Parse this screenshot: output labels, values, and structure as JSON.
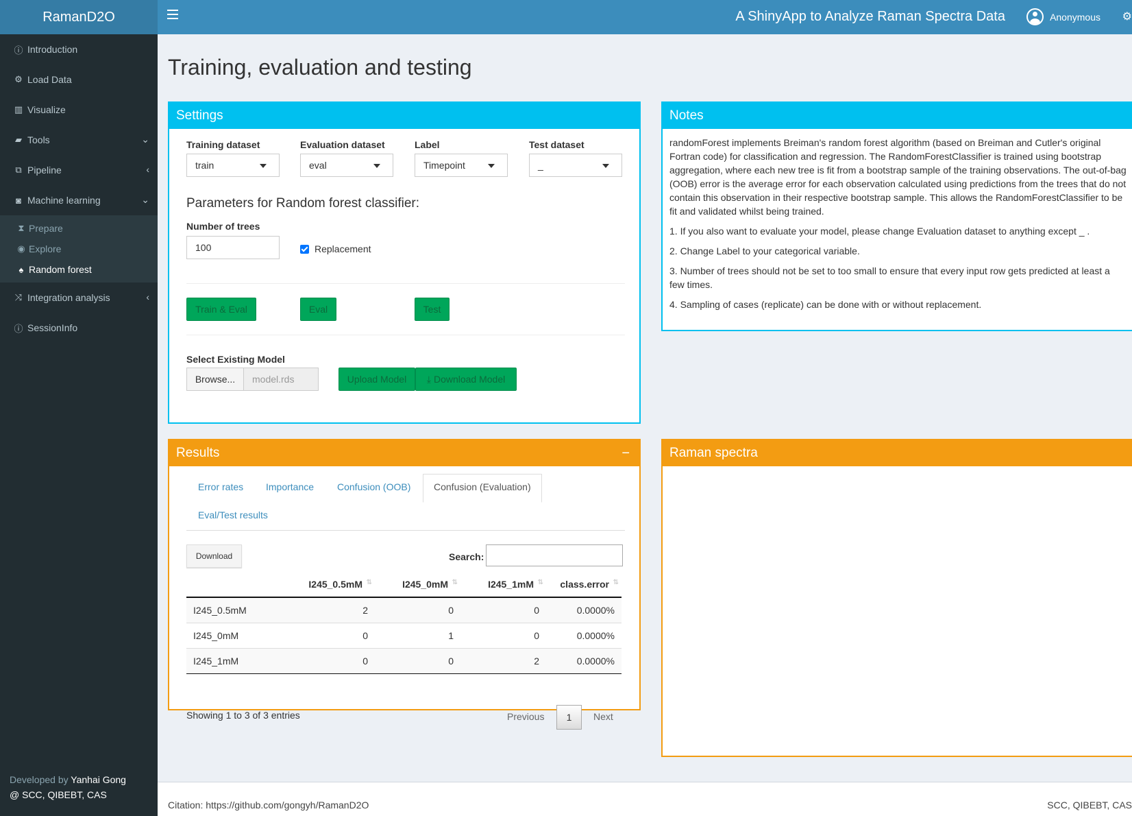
{
  "header": {
    "logo": "RamanD2O",
    "app_title": "A ShinyApp to Analyze Raman Spectra Data",
    "user": "Anonymous"
  },
  "sidebar": {
    "items": [
      {
        "label": "Introduction",
        "icon": "info-circle-icon"
      },
      {
        "label": "Load Data",
        "icon": "cogs-icon"
      },
      {
        "label": "Visualize",
        "icon": "chart-bar-icon"
      },
      {
        "label": "Tools",
        "icon": "toolbox-icon"
      },
      {
        "label": "Pipeline",
        "icon": "sitemap-icon"
      },
      {
        "label": "Machine learning",
        "icon": "robot-icon"
      },
      {
        "label": "Integration analysis",
        "icon": "random-icon"
      },
      {
        "label": "SessionInfo",
        "icon": "info-circle-icon"
      }
    ],
    "ml_submenu": [
      {
        "label": "Prepare",
        "icon": "hourglass-icon"
      },
      {
        "label": "Explore",
        "icon": "eye-icon"
      },
      {
        "label": "Random forest",
        "icon": "tree-icon"
      }
    ],
    "footer_prefix": "Developed by",
    "footer_name": "Yanhai Gong",
    "footer_org": "@ SCC, QIBEBT, CAS"
  },
  "page_title": "Training, evaluation and testing",
  "settings": {
    "title": "Settings",
    "training_label": "Training dataset",
    "training_value": "train",
    "evaluation_label": "Evaluation dataset",
    "evaluation_value": "eval",
    "label_label": "Label",
    "label_value": "Timepoint",
    "test_label": "Test dataset",
    "test_value": "_",
    "params_heading": "Parameters for Random forest classifier:",
    "trees_label": "Number of trees",
    "trees_value": "100",
    "replacement_label": "Replacement",
    "replacement_checked": true,
    "train_eval_btn": "Train & Eval",
    "eval_btn": "Eval",
    "test_btn": "Test",
    "existing_model_label": "Select Existing Model",
    "browse_btn": "Browse...",
    "file_name": "model.rds",
    "upload_btn": "Upload Model",
    "download_btn": "Download Model"
  },
  "notes": {
    "title": "Notes",
    "intro": "randomForest implements Breiman's random forest algorithm (based on Breiman and Cutler's original Fortran code) for classification and regression. The RandomForestClassifier is trained using bootstrap aggregation, where each new tree is fit from a bootstrap sample of the training observations. The out-of-bag (OOB) error is the average error for each observation calculated using predictions from the trees that do not contain this observation in their respective bootstrap sample. This allows the RandomForestClassifier to be fit and validated whilst being trained.",
    "note1": "1. If you also want to evaluate your model, please change Evaluation dataset to anything except _ .",
    "note2": "2. Change Label to your categorical variable.",
    "note3": "3. Number of trees should not be set to too small to ensure that every input row gets predicted at least a few times.",
    "note4": "4. Sampling of cases (replicate) can be done with or without replacement."
  },
  "results": {
    "title": "Results",
    "collapse": "−",
    "tabs": [
      "Error rates",
      "Importance",
      "Confusion (OOB)",
      "Confusion (Evaluation)",
      "Eval/Test results"
    ],
    "active_tab": "Confusion (Evaluation)",
    "download_btn": "Download",
    "search_label": "Search:",
    "search_value": "",
    "columns": [
      "",
      "I245_0.5mM",
      "I245_0mM",
      "I245_1mM",
      "class.error"
    ],
    "rows": [
      [
        "I245_0.5mM",
        "2",
        "0",
        "0",
        "0.0000%"
      ],
      [
        "I245_0mM",
        "0",
        "1",
        "0",
        "0.0000%"
      ],
      [
        "I245_1mM",
        "0",
        "0",
        "2",
        "0.0000%"
      ]
    ],
    "info": "Showing 1 to 3 of 3 entries",
    "prev": "Previous",
    "page": "1",
    "next": "Next"
  },
  "raman": {
    "title": "Raman spectra"
  },
  "footer": {
    "citation": "Citation: https://github.com/gongyh/RamanD2O",
    "org": "SCC, QIBEBT, CAS"
  },
  "colors": {
    "header": "#3c8dbc",
    "logo": "#357ca5",
    "sidebar": "#222d32",
    "info_box": "#00c0ef",
    "warning_box": "#f39c12",
    "success_button": "#00a65a"
  }
}
